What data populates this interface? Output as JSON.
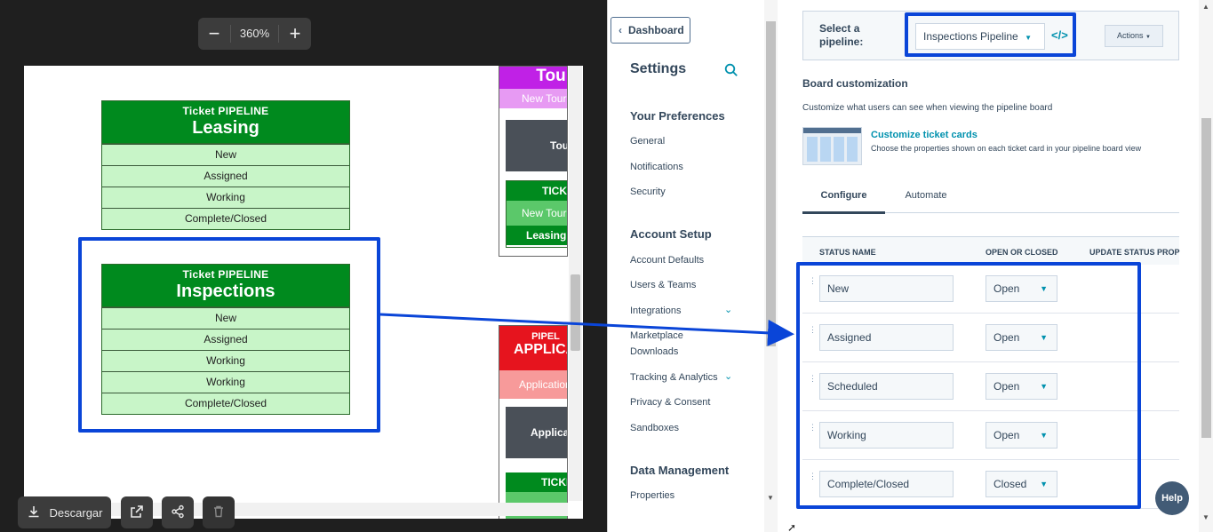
{
  "viewer": {
    "zoom": {
      "minus": "−",
      "value": "360%",
      "plus": "+"
    },
    "pipelines": [
      {
        "subtitle": "Ticket  PIPELINE",
        "title": "Leasing",
        "stages": [
          "New",
          "Assigned",
          "Working",
          "Complete/Closed"
        ]
      },
      {
        "subtitle": "Ticket  PIPELINE",
        "title": "Inspections",
        "stages": [
          "New",
          "Assigned",
          "Working",
          "Working",
          "Complete/Closed"
        ]
      }
    ],
    "right_partial": {
      "tour_title": "Tou",
      "tour_row": "New Tour",
      "tour_gray": "Tou",
      "ticket1": "TICKE",
      "ticket1_row": "New Tour",
      "ticket1_leasing": "Leasing",
      "pipel": "PIPEL",
      "applica": "APPLICA",
      "application": "Application",
      "applic_gray": "Applica",
      "ticket2": "TICKE"
    },
    "download_label": "Descargar"
  },
  "settings": {
    "back_label": "Dashboard",
    "title": "Settings",
    "nav": [
      {
        "label": "Your Preferences",
        "heading": true
      },
      {
        "label": "General"
      },
      {
        "label": "Notifications"
      },
      {
        "label": "Security"
      },
      {
        "label": "Account Setup",
        "heading": true
      },
      {
        "label": "Account Defaults"
      },
      {
        "label": "Users & Teams"
      },
      {
        "label": "Integrations",
        "expand": true
      },
      {
        "label": "Marketplace"
      },
      {
        "label": "Downloads"
      },
      {
        "label": "Tracking & Analytics",
        "expand": true
      },
      {
        "label": "Privacy & Consent"
      },
      {
        "label": "Sandboxes"
      },
      {
        "label": "Data Management",
        "heading": true
      },
      {
        "label": "Properties"
      }
    ],
    "select_label": "Select a pipeline:",
    "pipeline_value": "Inspections Pipeline",
    "actions_label": "Actions",
    "board_title": "Board customization",
    "board_desc": "Customize what users can see when viewing the pipeline board",
    "cards_link": "Customize ticket cards",
    "cards_desc": "Choose the properties shown on each ticket card in your pipeline board view",
    "tabs": [
      "Configure",
      "Automate"
    ],
    "columns": [
      "STATUS NAME",
      "OPEN OR CLOSED",
      "UPDATE STATUS PROP"
    ],
    "statuses": [
      {
        "name": "New",
        "state": "Open"
      },
      {
        "name": "Assigned",
        "state": "Open"
      },
      {
        "name": "Scheduled",
        "state": "Open"
      },
      {
        "name": "Working",
        "state": "Open"
      },
      {
        "name": "Complete/Closed",
        "state": "Closed"
      }
    ],
    "help_label": "Help"
  },
  "colors": {
    "highlight": "#0a45d8",
    "pipeline_green": "#008a1e",
    "stage_green": "#c8f5c8",
    "link": "#0091ae"
  }
}
